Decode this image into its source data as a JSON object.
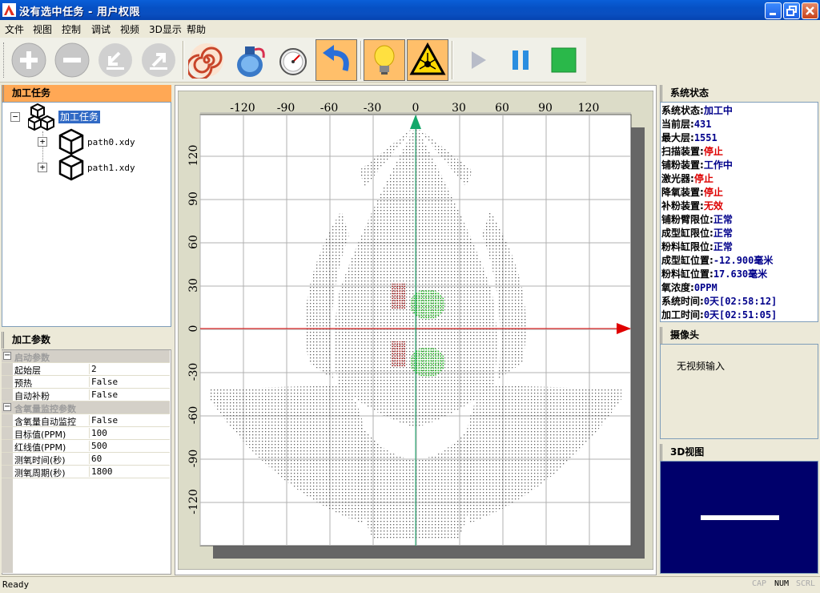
{
  "window": {
    "title": "没有选中任务 - 用户权限"
  },
  "menu": [
    "文件",
    "视图",
    "控制",
    "调试",
    "视频",
    "3D显示",
    "帮助"
  ],
  "toolbar": {
    "buttons": [
      "zoom-in",
      "zoom-out",
      "import",
      "export",
      "spiral-fill",
      "powder-supply",
      "oxygen-gauge",
      "reset-arrow",
      "light-bulb",
      "laser",
      "play",
      "pause",
      "stop"
    ]
  },
  "task_panel": {
    "title": "加工任务",
    "root": "加工任务",
    "children": [
      "path0.xdy",
      "path1.xdy"
    ]
  },
  "params_panel": {
    "title": "加工参数",
    "groups": [
      {
        "name": "启动参数",
        "rows": [
          {
            "name": "起始层",
            "value": "2"
          },
          {
            "name": "预热",
            "value": "False"
          },
          {
            "name": "自动补粉",
            "value": "False"
          }
        ]
      },
      {
        "name": "含氧量监控参数",
        "rows": [
          {
            "name": "含氧量自动监控",
            "value": "False"
          },
          {
            "name": "目标值(PPM)",
            "value": "100"
          },
          {
            "name": "红线值(PPM)",
            "value": "500"
          },
          {
            "name": "测氧时间(秒)",
            "value": "60"
          },
          {
            "name": "测氧周期(秒)",
            "value": "1800"
          }
        ]
      }
    ]
  },
  "plot": {
    "x_ticks": [
      "-120",
      "-90",
      "-60",
      "-30",
      "0",
      "30",
      "60",
      "90",
      "120"
    ],
    "y_ticks": [
      "120",
      "90",
      "60",
      "30",
      "0",
      "-30",
      "-60",
      "-90",
      "-120"
    ]
  },
  "status_panel": {
    "title": "系统状态",
    "rows": [
      {
        "key": "系统状态:",
        "value": "加工中",
        "color": "blue"
      },
      {
        "key": "当前层:",
        "value": "431",
        "color": "blue"
      },
      {
        "key": "最大层:",
        "value": "1551",
        "color": "blue"
      },
      {
        "key": "扫描装置:",
        "value": "停止",
        "color": "red"
      },
      {
        "key": "铺粉装置:",
        "value": "工作中",
        "color": "blue"
      },
      {
        "key": "激光器:",
        "value": "停止",
        "color": "red"
      },
      {
        "key": "降氧装置:",
        "value": "停止",
        "color": "red"
      },
      {
        "key": "补粉装置:",
        "value": "无效",
        "color": "red"
      },
      {
        "key": "铺粉臂限位:",
        "value": "正常",
        "color": "blue"
      },
      {
        "key": "成型缸限位:",
        "value": "正常",
        "color": "blue"
      },
      {
        "key": "粉料缸限位:",
        "value": "正常",
        "color": "blue"
      },
      {
        "key": "成型缸位置:",
        "value": "-12.900毫米",
        "color": "blue"
      },
      {
        "key": "粉料缸位置:",
        "value": "17.630毫米",
        "color": "blue"
      },
      {
        "key": "氧浓度:",
        "value": "0PPM",
        "color": "blue"
      },
      {
        "key": "系统时间:",
        "value": "0天[02:58:12]",
        "color": "blue"
      },
      {
        "key": "加工时间:",
        "value": "0天[02:51:05]",
        "color": "blue"
      }
    ]
  },
  "camera_panel": {
    "title": "摄像头",
    "message": "无视频输入"
  },
  "view3d_panel": {
    "title": "3D视图"
  },
  "statusbar": {
    "ready": "Ready",
    "indicators": [
      "CAP",
      "NUM",
      "SCRL"
    ]
  }
}
